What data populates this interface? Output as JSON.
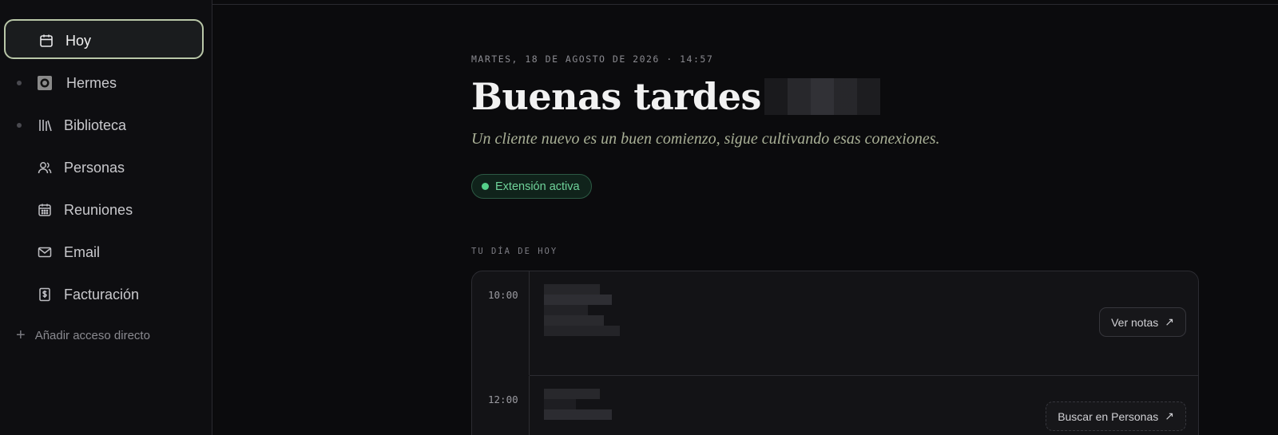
{
  "sidebar": {
    "items": [
      {
        "label": "Hoy",
        "icon": "calendar-icon",
        "active": true,
        "dot": true
      },
      {
        "label": "Hermes",
        "icon": "hermes-icon",
        "active": false,
        "dot": true
      },
      {
        "label": "Biblioteca",
        "icon": "library-icon",
        "active": false,
        "dot": true
      },
      {
        "label": "Personas",
        "icon": "people-icon",
        "active": false,
        "dot": false
      },
      {
        "label": "Reuniones",
        "icon": "calendar-grid-icon",
        "active": false,
        "dot": false
      },
      {
        "label": "Email",
        "icon": "mail-icon",
        "active": false,
        "dot": false
      },
      {
        "label": "Facturación",
        "icon": "invoice-icon",
        "active": false,
        "dot": false
      }
    ],
    "add_shortcut": "Añadir acceso directo"
  },
  "main": {
    "dateline": "MARTES, 18 DE AGOSTO DE 2026 · 14:57",
    "greeting": "Buenas tardes",
    "subtitle": "Un cliente nuevo es un buen comienzo, sigue cultivando esas conexiones.",
    "status_badge": "Extensión activa",
    "section_label": "TU DÍA DE HOY",
    "agenda": [
      {
        "time": "10:00",
        "action": "Ver notas"
      },
      {
        "time": "12:00",
        "action": "Buscar en Personas"
      }
    ]
  },
  "colors": {
    "accent_border": "#b9c7a8",
    "status_green": "#6fd39a",
    "subtitle": "#a9b096"
  }
}
